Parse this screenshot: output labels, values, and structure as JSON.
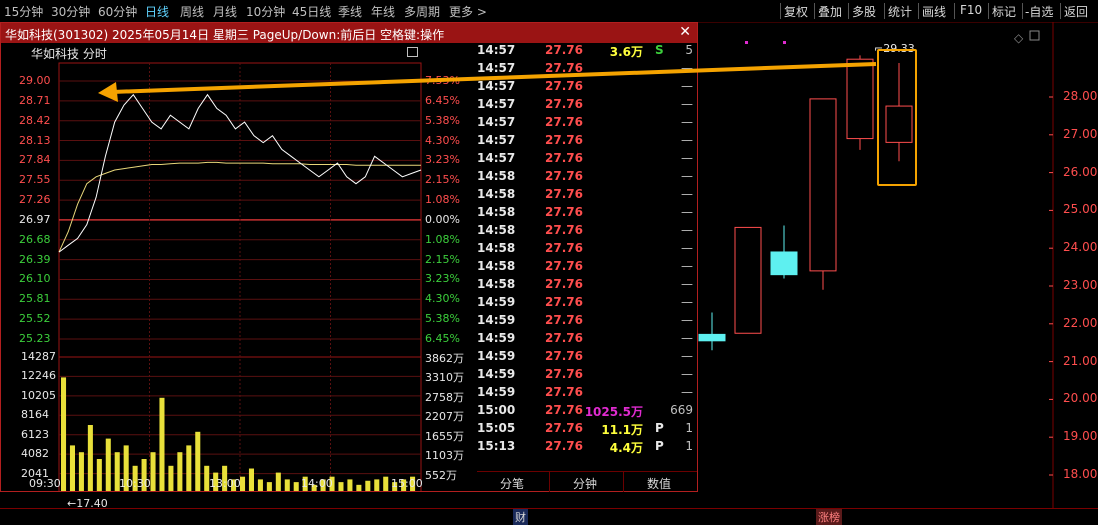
{
  "toolbar": {
    "periods": [
      "15分钟",
      "30分钟",
      "60分钟",
      "日线",
      "周线",
      "月线",
      "10分钟",
      "45日线",
      "季线",
      "年线",
      "多周期",
      "更多"
    ],
    "active_period": "日线",
    "right_buttons": [
      "复权",
      "叠加",
      "多股",
      "统计",
      "画线",
      "F10",
      "标记",
      "-自选",
      "返回"
    ]
  },
  "popup": {
    "title": "华如科技(301302) 2025年05月14日 星期三 PageUp/Down:前后日 空格键:操作",
    "chart_title": "华如科技  分时"
  },
  "chart_data": {
    "type": "line",
    "title": "华如科技  分时",
    "prev_close": 26.97,
    "ylim": [
      25.23,
      29.0
    ],
    "price_ticks": [
      "29.00",
      "28.71",
      "28.42",
      "28.13",
      "27.84",
      "27.55",
      "27.26",
      "26.97",
      "26.68",
      "26.39",
      "26.10",
      "25.81",
      "25.52",
      "25.23"
    ],
    "pct_ticks": [
      "7.53%",
      "6.45%",
      "5.38%",
      "4.30%",
      "3.23%",
      "2.15%",
      "1.08%",
      "0.00%",
      "1.08%",
      "2.15%",
      "3.23%",
      "4.30%",
      "5.38%",
      "6.45%"
    ],
    "volume_ticks": [
      "14287",
      "12246",
      "10205",
      "8164",
      "6123",
      "4082",
      "2041"
    ],
    "amount_ticks": [
      "3862万",
      "3310万",
      "2758万",
      "2207万",
      "1655万",
      "1103万",
      "552万"
    ],
    "x_labels": [
      "09:30",
      "10:30",
      "13:00",
      "14:00",
      "15:00"
    ],
    "series": [
      {
        "values": [
          26.5,
          26.6,
          26.7,
          26.9,
          27.3,
          27.9,
          28.4,
          28.65,
          28.8,
          28.6,
          28.4,
          28.3,
          28.5,
          28.4,
          28.3,
          28.6,
          28.8,
          28.6,
          28.5,
          28.3,
          28.4,
          28.2,
          28.1,
          28.2,
          28.0,
          27.9,
          27.8,
          27.7,
          27.6,
          27.7,
          27.8,
          27.6,
          27.5,
          27.6,
          27.9,
          27.8,
          27.7,
          27.6,
          27.65,
          27.7
        ]
      },
      {
        "values": [
          26.5,
          26.8,
          27.2,
          27.5,
          27.6,
          27.65,
          27.7,
          27.72,
          27.74,
          27.76,
          27.78,
          27.78,
          27.79,
          27.8,
          27.8,
          27.8,
          27.81,
          27.81,
          27.8,
          27.8,
          27.8,
          27.8,
          27.8,
          27.79,
          27.79,
          27.79,
          27.79,
          27.78,
          27.78,
          27.78,
          27.78,
          27.78,
          27.77,
          27.77,
          27.77,
          27.77,
          27.77,
          27.77,
          27.77,
          27.77
        ]
      }
    ],
    "volume_fraction": [
      0.85,
      0.35,
      0.3,
      0.5,
      0.25,
      0.4,
      0.3,
      0.35,
      0.2,
      0.25,
      0.3,
      0.7,
      0.2,
      0.3,
      0.35,
      0.45,
      0.2,
      0.15,
      0.2,
      0.1,
      0.12,
      0.18,
      0.1,
      0.08,
      0.15,
      0.1,
      0.08,
      0.12,
      0.06,
      0.1,
      0.12,
      0.08,
      0.1,
      0.06,
      0.09,
      0.1,
      0.12,
      0.08,
      0.1,
      0.12
    ],
    "low_marker": "←17.40"
  },
  "ticks": [
    {
      "time": "14:57",
      "price": "27.76",
      "vol": "3.6万",
      "bs": "S",
      "count": "5",
      "vol_color": "yellow",
      "bs_color": "green"
    },
    {
      "time": "14:57",
      "price": "27.76",
      "vol": "",
      "bs": "",
      "count": "—"
    },
    {
      "time": "14:57",
      "price": "27.76",
      "vol": "",
      "bs": "",
      "count": "—"
    },
    {
      "time": "14:57",
      "price": "27.76",
      "vol": "",
      "bs": "",
      "count": "—"
    },
    {
      "time": "14:57",
      "price": "27.76",
      "vol": "",
      "bs": "",
      "count": "—"
    },
    {
      "time": "14:57",
      "price": "27.76",
      "vol": "",
      "bs": "",
      "count": "—"
    },
    {
      "time": "14:57",
      "price": "27.76",
      "vol": "",
      "bs": "",
      "count": "—"
    },
    {
      "time": "14:58",
      "price": "27.76",
      "vol": "",
      "bs": "",
      "count": "—"
    },
    {
      "time": "14:58",
      "price": "27.76",
      "vol": "",
      "bs": "",
      "count": "—"
    },
    {
      "time": "14:58",
      "price": "27.76",
      "vol": "",
      "bs": "",
      "count": "—"
    },
    {
      "time": "14:58",
      "price": "27.76",
      "vol": "",
      "bs": "",
      "count": "—"
    },
    {
      "time": "14:58",
      "price": "27.76",
      "vol": "",
      "bs": "",
      "count": "—"
    },
    {
      "time": "14:58",
      "price": "27.76",
      "vol": "",
      "bs": "",
      "count": "—"
    },
    {
      "time": "14:58",
      "price": "27.76",
      "vol": "",
      "bs": "",
      "count": "—"
    },
    {
      "time": "14:59",
      "price": "27.76",
      "vol": "",
      "bs": "",
      "count": "—"
    },
    {
      "time": "14:59",
      "price": "27.76",
      "vol": "",
      "bs": "",
      "count": "—"
    },
    {
      "time": "14:59",
      "price": "27.76",
      "vol": "",
      "bs": "",
      "count": "—"
    },
    {
      "time": "14:59",
      "price": "27.76",
      "vol": "",
      "bs": "",
      "count": "—"
    },
    {
      "time": "14:59",
      "price": "27.76",
      "vol": "",
      "bs": "",
      "count": "—"
    },
    {
      "time": "14:59",
      "price": "27.76",
      "vol": "",
      "bs": "",
      "count": "—"
    },
    {
      "time": "15:00",
      "price": "27.76",
      "vol": "1025.5万",
      "bs": "",
      "count": "669",
      "vol_color": "magenta"
    },
    {
      "time": "15:05",
      "price": "27.76",
      "vol": "11.1万",
      "bs": "P",
      "count": "1",
      "vol_color": "yellow",
      "bs_color": "white"
    },
    {
      "time": "15:13",
      "price": "27.76",
      "vol": "4.4万",
      "bs": "P",
      "count": "1",
      "vol_color": "yellow",
      "bs_color": "white"
    }
  ],
  "bottom_tabs": [
    "分笔",
    "分钟",
    "数值"
  ],
  "kline": {
    "axis": [
      "28.00",
      "27.00",
      "26.00",
      "25.00",
      "24.00",
      "23.00",
      "22.00",
      "21.00",
      "20.00",
      "19.00",
      "18.00"
    ],
    "high_label": "29.33",
    "candles": [
      {
        "open": 21.72,
        "close": 21.55,
        "high": 22.3,
        "low": 21.3
      },
      {
        "open": 21.75,
        "close": 24.55,
        "high": 24.55,
        "low": 21.75
      },
      {
        "open": 23.9,
        "close": 23.3,
        "high": 24.6,
        "low": 23.2
      },
      {
        "open": 23.4,
        "close": 27.95,
        "high": 27.95,
        "low": 22.9
      },
      {
        "open": 26.9,
        "close": 29.0,
        "high": 29.1,
        "low": 26.6
      },
      {
        "open": 26.8,
        "close": 27.76,
        "high": 28.9,
        "low": 26.3
      }
    ],
    "markers": [
      "财",
      "涨榜"
    ]
  }
}
